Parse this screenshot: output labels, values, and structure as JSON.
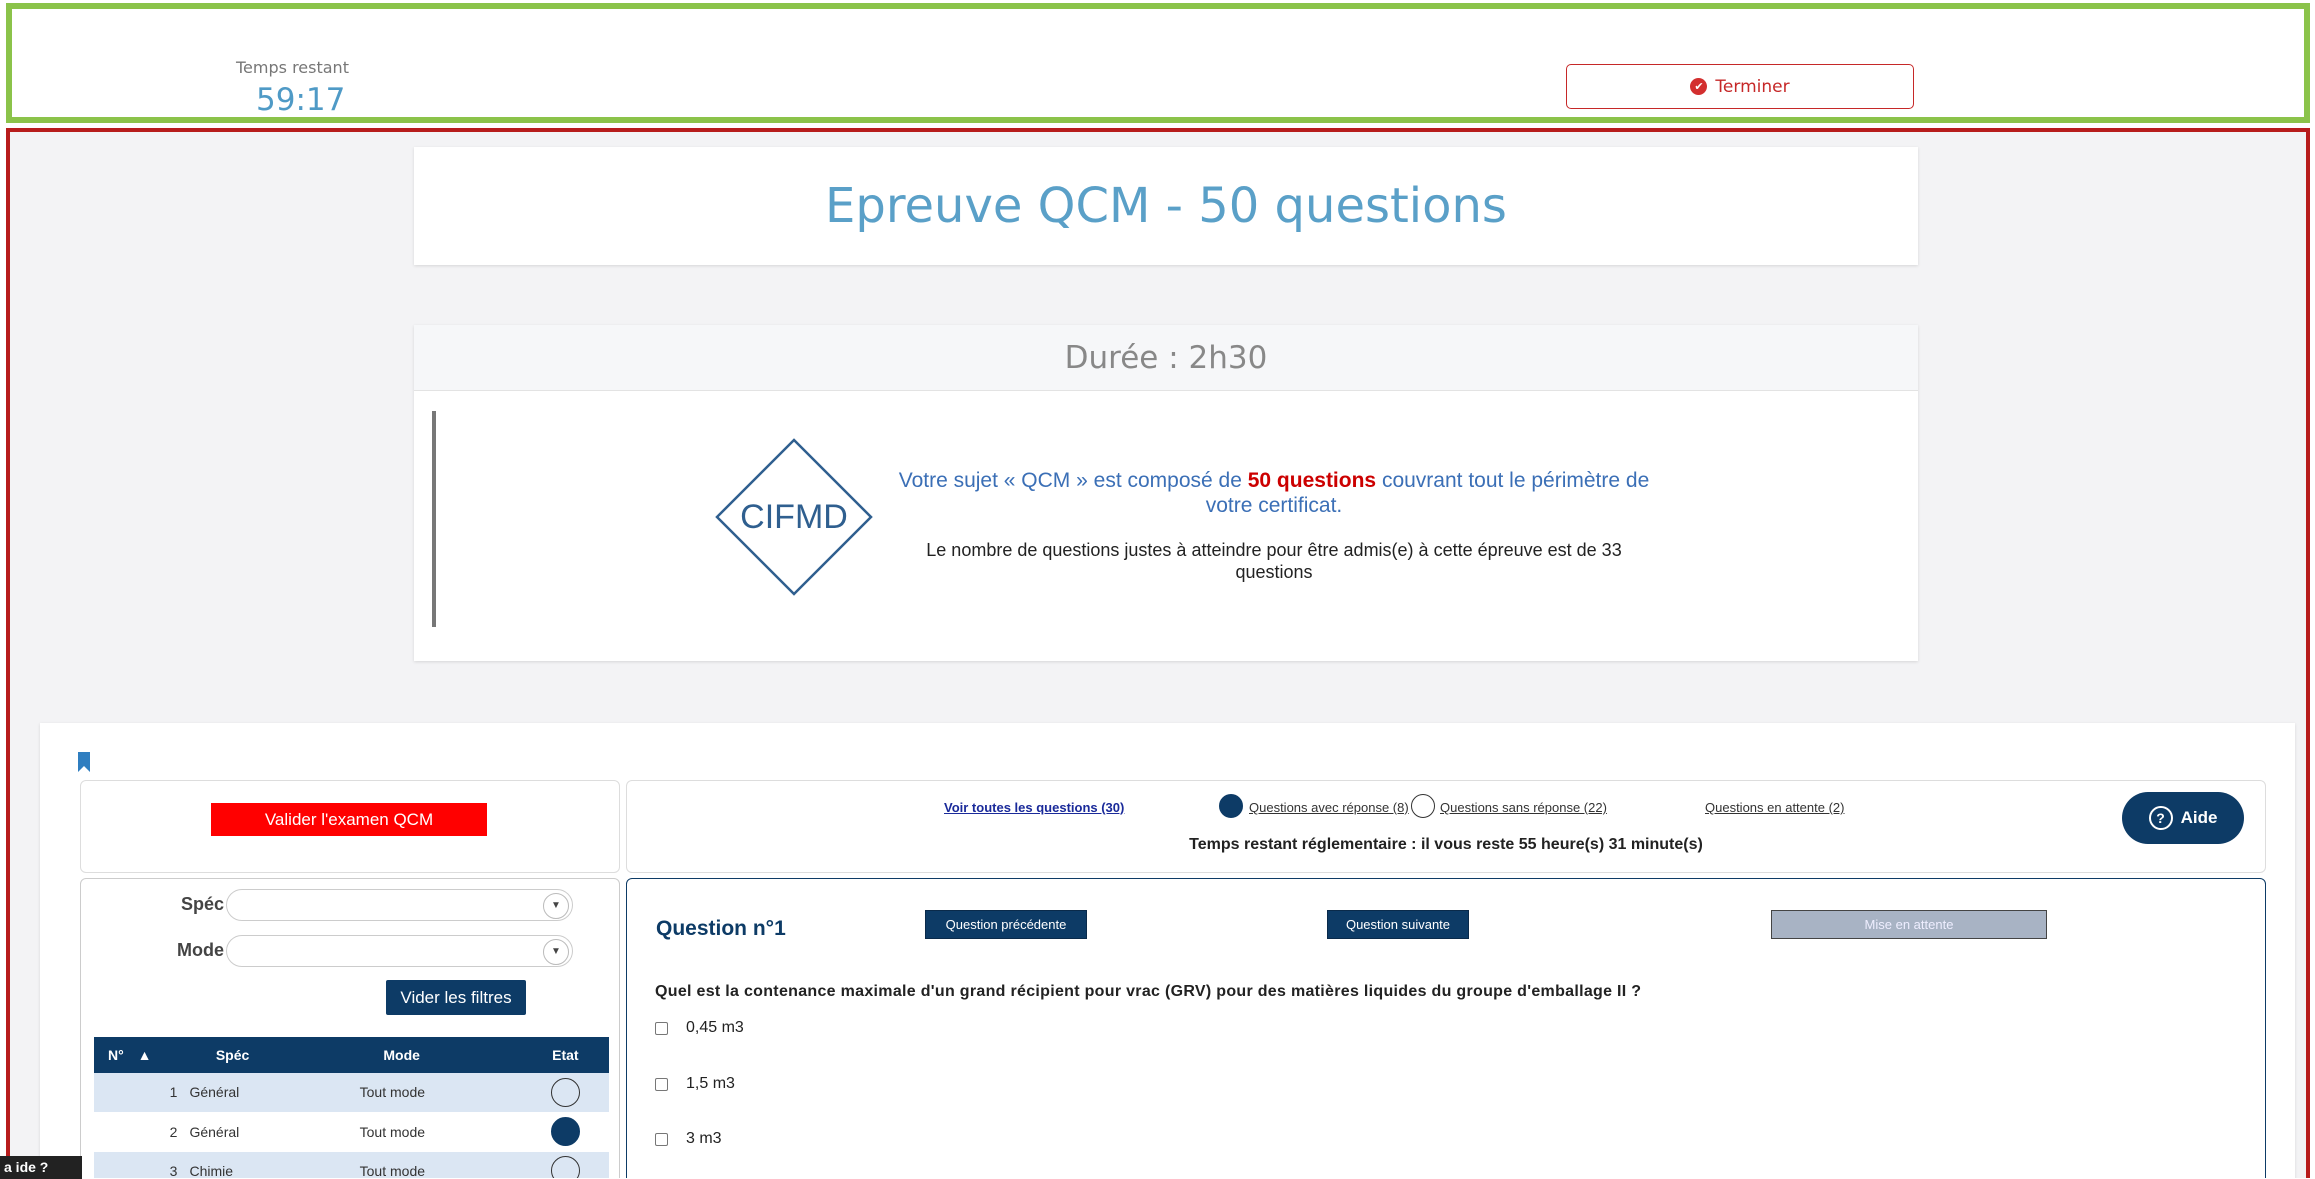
{
  "timer": {
    "label": "Temps restant",
    "value": "59:17"
  },
  "finish_button": {
    "label": "Terminer",
    "icon": "check-circle-icon"
  },
  "exam": {
    "title": "Epreuve QCM - 50 questions",
    "duration": "Durée : 2h30",
    "logo_text": "CIFMD",
    "info_pre": "Votre sujet « QCM » est composé de ",
    "info_bold": "50 questions",
    "info_post": " couvrant tout le périmètre de votre certificat.",
    "info_threshold": "Le nombre de questions justes à atteindre pour être admis(e) à cette épreuve est de 33 questions"
  },
  "sidebar": {
    "validate_label": "Valider l'examen QCM",
    "filter_spec_label": "Spéc",
    "filter_mode_label": "Mode",
    "clear_filters_label": "Vider les filtres",
    "table_headers": {
      "num": "N°",
      "spec": "Spéc",
      "mode": "Mode",
      "state": "Etat"
    },
    "rows": [
      {
        "num": "1",
        "spec": "Général",
        "mode": "Tout mode",
        "state": "empty"
      },
      {
        "num": "2",
        "spec": "Général",
        "mode": "Tout mode",
        "state": "answered"
      },
      {
        "num": "3",
        "spec": "Chimie",
        "mode": "Tout mode",
        "state": "empty"
      }
    ]
  },
  "nav": {
    "all": "Voir toutes les questions (30)",
    "answered": "Questions avec réponse (8)",
    "unanswered": "Questions sans réponse (22)",
    "pending": "Questions en attente (2)",
    "reg_time": "Temps restant réglementaire : il vous reste 55 heure(s) 31 minute(s)"
  },
  "help_button": {
    "label": "Aide"
  },
  "question": {
    "title": "Question n°1",
    "prev_label": "Question précédente",
    "next_label": "Question suivante",
    "wait_label": "Mise en attente",
    "text": "Quel est la contenance maximale d'un grand récipient pour vrac (GRV) pour des matières liquides du groupe d'emballage II ?",
    "options": [
      "0,45 m3",
      "1,5 m3",
      "3 m3"
    ]
  },
  "help_tab": {
    "label": "a ide ?"
  },
  "colors": {
    "navy": "#0d3b66",
    "green_frame": "#8bc34a",
    "red_frame": "#b71c1c",
    "title_blue": "#5aa0c8"
  }
}
